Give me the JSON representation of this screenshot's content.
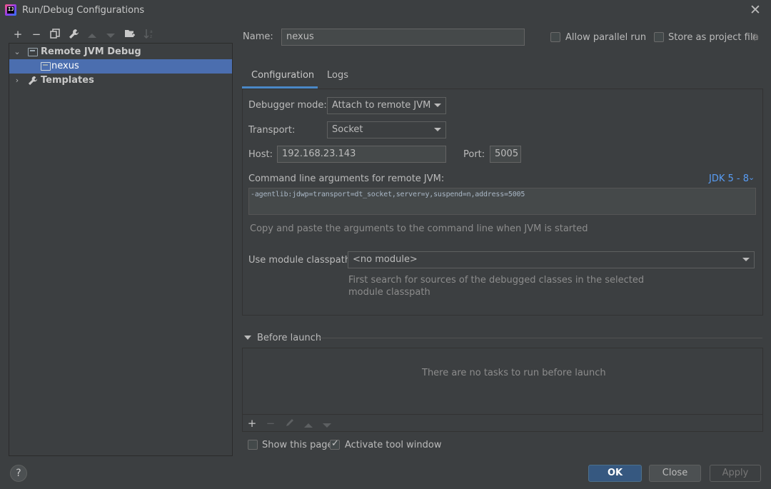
{
  "window": {
    "title": "Run/Debug Configurations",
    "app_icon_text": "IJ"
  },
  "tree": {
    "group_label": "Remote JVM Debug",
    "selected_item": "nexus",
    "templates_label": "Templates"
  },
  "form": {
    "name_label": "Name:",
    "name_value": "nexus",
    "allow_parallel_label": "Allow parallel run",
    "store_project_label": "Store as project file"
  },
  "tabs": {
    "configuration": "Configuration",
    "logs": "Logs"
  },
  "config": {
    "debugger_mode_label": "Debugger mode:",
    "debugger_mode_value": "Attach to remote JVM",
    "transport_label": "Transport:",
    "transport_value": "Socket",
    "host_label": "Host:",
    "host_value": "192.168.23.143",
    "port_label": "Port:",
    "port_value": "5005",
    "cmd_label": "Command line arguments for remote JVM:",
    "jdk_link": "JDK 5 - 8",
    "cmd_value": "-agentlib:jdwp=transport=dt_socket,server=y,suspend=n,address=5005",
    "cmd_hint": "Copy and paste the arguments to the command line when JVM is started",
    "module_label": "Use module classpath:",
    "module_value": "<no module>",
    "module_hint_1": "First search for sources of the debugged classes in the selected",
    "module_hint_2": "module classpath"
  },
  "before_launch": {
    "title": "Before launch",
    "empty_text": "There are no tasks to run before launch"
  },
  "options": {
    "show_page_label": "Show this page",
    "show_page_checked": false,
    "activate_tool_label": "Activate tool window",
    "activate_tool_checked": true
  },
  "buttons": {
    "ok": "OK",
    "close": "Close",
    "apply": "Apply",
    "help": "?"
  },
  "colors": {
    "accent": "#4a88c7",
    "ok_button": "#365880",
    "selection": "#4b6eaf",
    "link": "#589df6",
    "background": "#3c3f41"
  },
  "icons": {
    "left_toolbar": [
      "plus-icon",
      "minus-icon",
      "copy-icon",
      "wrench-icon",
      "move-up-icon",
      "move-down-icon",
      "new-folder-icon",
      "sort-icon"
    ],
    "before_toolbar": [
      "plus-icon",
      "minus-icon",
      "pencil-icon",
      "move-up-icon",
      "move-down-icon"
    ]
  }
}
